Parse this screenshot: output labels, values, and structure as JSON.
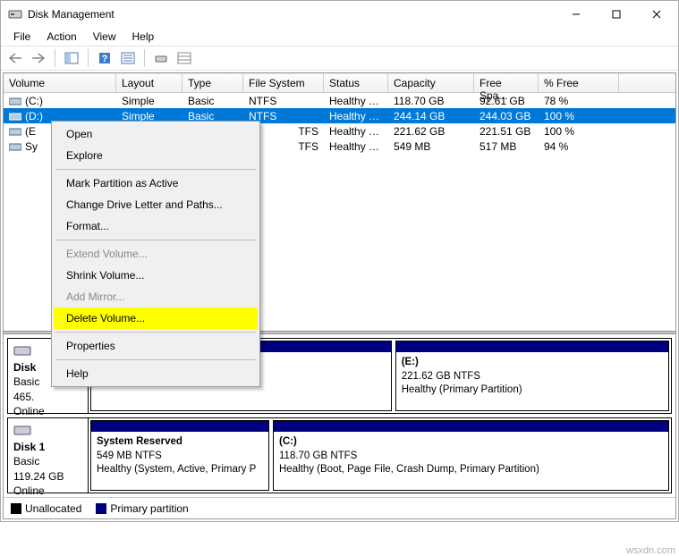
{
  "window": {
    "title": "Disk Management"
  },
  "menus": {
    "file": "File",
    "action": "Action",
    "view": "View",
    "help": "Help"
  },
  "columns": {
    "volume": "Volume",
    "layout": "Layout",
    "type": "Type",
    "fs": "File System",
    "status": "Status",
    "capacity": "Capacity",
    "free": "Free Spa...",
    "pct": "% Free"
  },
  "rows": [
    {
      "volume": "(C:)",
      "layout": "Simple",
      "type": "Basic",
      "fs": "NTFS",
      "status": "Healthy (B...",
      "capacity": "118.70 GB",
      "free": "92.61 GB",
      "pct": "78 %",
      "selected": false
    },
    {
      "volume": "(D:)",
      "layout": "Simple",
      "type": "Basic",
      "fs": "NTFS",
      "status": "Healthy (P...",
      "capacity": "244.14 GB",
      "free": "244.03 GB",
      "pct": "100 %",
      "selected": true
    },
    {
      "volume": "(E",
      "layout": "",
      "type": "",
      "fs": "TFS",
      "status": "Healthy (P...",
      "capacity": "221.62 GB",
      "free": "221.51 GB",
      "pct": "100 %",
      "selected": false
    },
    {
      "volume": "Sy",
      "layout": "",
      "type": "",
      "fs": "TFS",
      "status": "Healthy (S...",
      "capacity": "549 MB",
      "free": "517 MB",
      "pct": "94 %",
      "selected": false
    }
  ],
  "context": {
    "open": "Open",
    "explore": "Explore",
    "mark": "Mark Partition as Active",
    "change": "Change Drive Letter and Paths...",
    "format": "Format...",
    "extend": "Extend Volume...",
    "shrink": "Shrink Volume...",
    "mirror": "Add Mirror...",
    "delete": "Delete Volume...",
    "properties": "Properties",
    "help": "Help"
  },
  "disk0": {
    "name": "Disk",
    "type": "Basic",
    "size": "465.",
    "status": "Online",
    "partE": {
      "label": "(E:)",
      "line2": "221.62 GB NTFS",
      "line3": "Healthy (Primary Partition)"
    }
  },
  "disk1": {
    "name": "Disk 1",
    "type": "Basic",
    "size": "119.24 GB",
    "status": "Online",
    "part0": {
      "label": "System Reserved",
      "line2": "549 MB NTFS",
      "line3": "Healthy (System, Active, Primary P"
    },
    "part1": {
      "label": "(C:)",
      "line2": "118.70 GB NTFS",
      "line3": "Healthy (Boot, Page File, Crash Dump, Primary Partition)"
    }
  },
  "legend": {
    "unalloc": "Unallocated",
    "primary": "Primary partition"
  },
  "watermark": "wsxdn.com"
}
